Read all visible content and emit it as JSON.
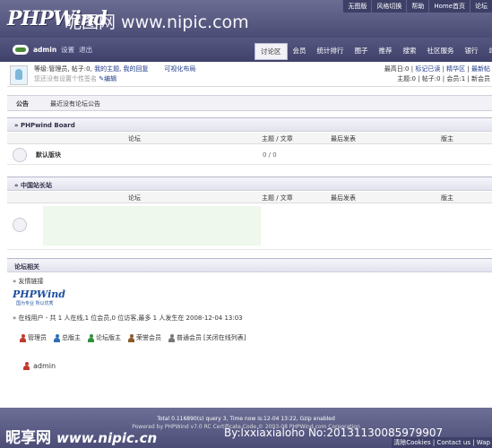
{
  "header": {
    "logo": "PHPWind",
    "watermark": "昵图网 www.nipic.com",
    "top_links": [
      "无图版",
      "风格切换",
      "帮助",
      "Home首页",
      "论坛"
    ]
  },
  "navbar": {
    "username": "admin",
    "settings": "设置",
    "logout": "退出",
    "items": [
      "讨论区",
      "会员",
      "统计排行",
      "圈子",
      "推荐",
      "搜索",
      "社区服务",
      "银行",
      "站长"
    ]
  },
  "info": {
    "line1_prefix": "等级:管理员, 帖子:0,",
    "my_topics": "我的主题",
    "my_replies": "我的回复",
    "layout": "可视化布局",
    "line2": "您还没有设置个性签名",
    "edit": "编辑",
    "right1_label": "最高日:0 |",
    "mark_read": "标记已读",
    "right1_sep": "|",
    "essence": "精华区",
    "right1_sep2": "|",
    "newest": "最新帖",
    "right2": "主题:0 | 帖子:0 | 会员:1 | 新会员"
  },
  "announcement": {
    "label": "公告",
    "text": "最近没有论坛公告"
  },
  "board1": {
    "title": "» PHPwind Board",
    "headers": [
      "论坛",
      "主题 / 文章",
      "最后发表",
      "版主"
    ],
    "rows": [
      {
        "name": "默认版块",
        "stats": "0 / 0"
      }
    ]
  },
  "board2": {
    "title": "» 中国站长站",
    "headers": [
      "论坛",
      "主题 / 文章",
      "最后发表",
      "版主"
    ]
  },
  "related": {
    "title": "论坛相关",
    "links_label": "» 友情链接",
    "phpwind_logo": "PHPWind",
    "phpwind_sub": "国为专业 所以优秀",
    "online_line": "» 在线用户 - 共 1 人在线,1 位会员,0 位访客,最多 1 人发生在 2008-12-04 13:03",
    "legend": [
      {
        "label": "管理员",
        "color": "#c0392b"
      },
      {
        "label": "总版主",
        "color": "#2c6fb7"
      },
      {
        "label": "论坛版主",
        "color": "#2f8f3a"
      },
      {
        "label": "荣誉会员",
        "color": "#8a5a2b"
      },
      {
        "label": "普通会员",
        "color": "#777777"
      }
    ],
    "close_list": "[关闭在线列表]",
    "online_user": "admin"
  },
  "footer": {
    "line1": "Total 0.116890(s) query 3, Time now is:12-04 13:22, Gzip enabled",
    "line2": "Powered by PHPWind v7.0 RC Certificate Code © 2003-08 PHPWind.com Corporation",
    "watermark_zh": "昵享网",
    "watermark_url": "www.nipic.cn",
    "watermark_id": "By:lxxiaxialoho No:20131130085979907",
    "bottom_links": "清除Cookies | Contact us | Wap"
  }
}
